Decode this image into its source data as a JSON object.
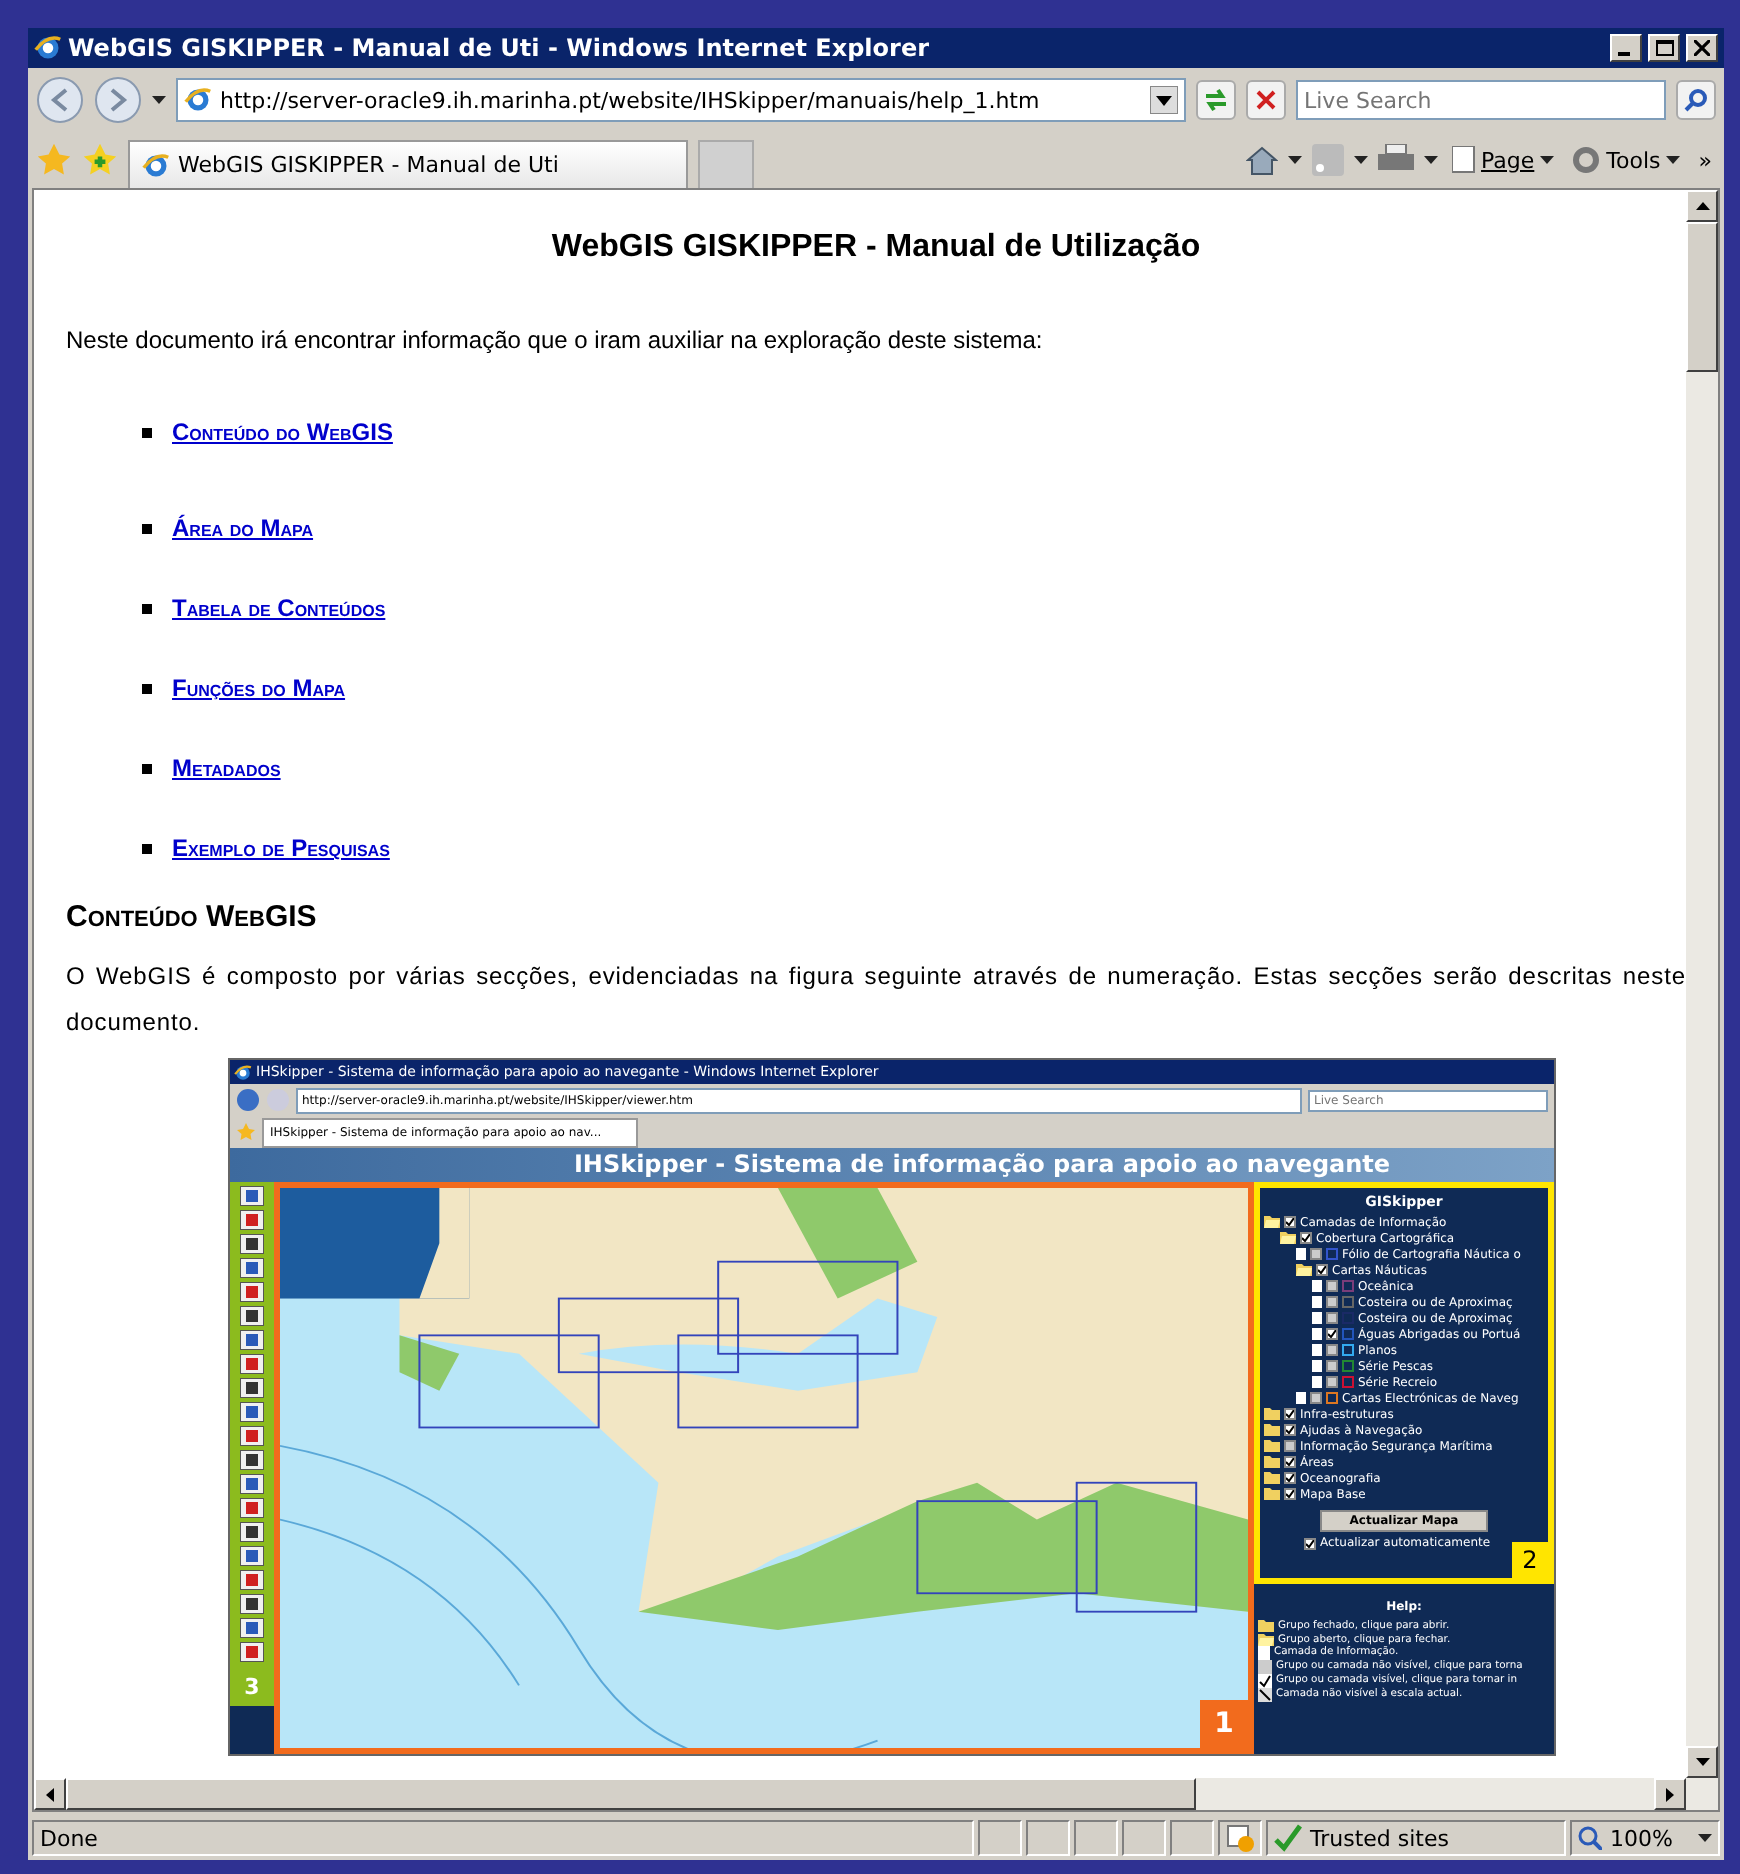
{
  "window": {
    "title": "WebGIS GISKIPPER - Manual de Uti - Windows Internet Explorer"
  },
  "address_bar": {
    "url": "http://server-oracle9.ih.marinha.pt/website/IHSkipper/manuais/help_1.htm"
  },
  "search": {
    "placeholder": "Live Search"
  },
  "tab": {
    "title": "WebGIS GISKIPPER - Manual de Uti"
  },
  "command_bar": {
    "page": "Page",
    "tools": "Tools",
    "more": "»"
  },
  "page": {
    "heading": "WebGIS GISKIPPER - Manual de Utilização",
    "intro": "Neste documento irá encontrar informação que o iram auxiliar na exploração deste sistema:",
    "links": [
      "Conteúdo do WebGIS",
      "Área do Mapa",
      "Tabela de Conteúdos",
      "Funções do Mapa",
      "Metadados",
      "Exemplo de Pesquisas"
    ],
    "section_heading": "Conteúdo WebGIS",
    "section_text": "O WebGIS é composto por várias secções, evidenciadas na figura seguinte através de numeração. Estas secções serão descritas neste documento.",
    "figure": {
      "window_title": "IHSkipper - Sistema de informação para apoio ao navegante - Windows Internet Explorer",
      "url": "http://server-oracle9.ih.marinha.pt/website/IHSkipper/viewer.htm",
      "search_placeholder": "Live Search",
      "tab_title": "IHSkipper - Sistema de informação para apoio ao nav...",
      "banner": "IHSkipper - Sistema de informação para apoio ao navegante",
      "toolbar_number": "3",
      "map_number": "1",
      "panel_number": "2",
      "panel_title": "GISkipper",
      "layers": [
        {
          "label": "Camadas de Informação",
          "checked": true,
          "expanded": true,
          "children": [
            {
              "label": "Cobertura Cartográfica",
              "checked": true,
              "expanded": true,
              "children": [
                {
                  "label": "Fólio de Cartografia Náutica o",
                  "checked": false,
                  "color": "#3355cc"
                },
                {
                  "label": "Cartas Náuticas",
                  "checked": true,
                  "expanded": true,
                  "children": [
                    {
                      "label": "Oceânica",
                      "checked": false,
                      "color": "#7a3d7a"
                    },
                    {
                      "label": "Costeira ou de Aproximaç",
                      "checked": false,
                      "color": "#666666"
                    },
                    {
                      "label": "Costeira ou de Aproximaç",
                      "checked": false,
                      "color": "#1a2a66"
                    },
                    {
                      "label": "Águas Abrigadas ou Portuá",
                      "checked": true,
                      "color": "#2255bb"
                    },
                    {
                      "label": "Planos",
                      "checked": false,
                      "color": "#33aaee"
                    },
                    {
                      "label": "Série Pescas",
                      "checked": false,
                      "color": "#228833"
                    },
                    {
                      "label": "Série Recreio",
                      "checked": false,
                      "color": "#cc1133"
                    }
                  ]
                },
                {
                  "label": "Cartas Electrónicas de Naveg",
                  "checked": false,
                  "color": "#dd7722"
                }
              ]
            }
          ]
        },
        {
          "label": "Infra-estruturas",
          "checked": true,
          "expanded": false
        },
        {
          "label": "Ajudas à Navegação",
          "checked": true,
          "expanded": false
        },
        {
          "label": "Informação Segurança Marítima",
          "checked": false,
          "expanded": false
        },
        {
          "label": "Áreas",
          "checked": true,
          "expanded": false
        },
        {
          "label": "Oceanografia",
          "checked": true,
          "expanded": false
        },
        {
          "label": "Mapa Base",
          "checked": true,
          "expanded": false
        }
      ],
      "update_button": "Actualizar Mapa",
      "auto_update": {
        "label": "Actualizar automaticamente",
        "checked": true
      },
      "help_title": "Help:",
      "help_items": [
        {
          "kind": "closed",
          "text": "Grupo fechado, clique para abrir."
        },
        {
          "kind": "open",
          "text": "Grupo aberto, clique para fechar."
        },
        {
          "kind": "layer",
          "text": "Camada de Informação."
        },
        {
          "kind": "hidden",
          "text": "Grupo ou camada não visível, clique para torna"
        },
        {
          "kind": "visible",
          "text": "Grupo ou camada visível, clique para tornar in"
        },
        {
          "kind": "scale",
          "text": "Camada não visível à escala actual."
        }
      ]
    }
  },
  "status_bar": {
    "text": "Done",
    "zone": "Trusted sites",
    "zoom": "100%"
  }
}
